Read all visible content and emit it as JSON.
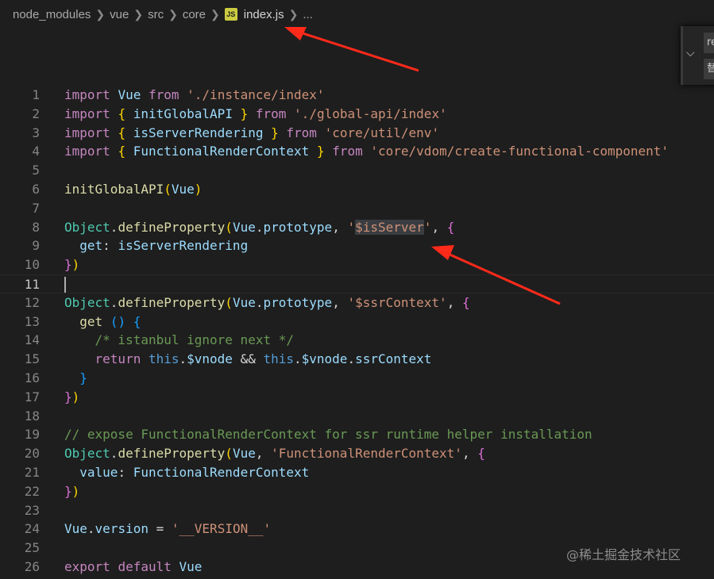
{
  "breadcrumb": {
    "items": [
      "node_modules",
      "vue",
      "src",
      "core"
    ],
    "file_icon": "JS",
    "file": "index.js",
    "more": "..."
  },
  "find_widget": {
    "toggle_icon": "chevron-down-icon",
    "find_value": "re",
    "replace_value": "替"
  },
  "editor": {
    "lines": [
      {
        "n": "1",
        "tokens": [
          [
            "kw",
            "import"
          ],
          [
            "punc",
            " "
          ],
          [
            "id",
            "Vue"
          ],
          [
            "punc",
            " "
          ],
          [
            "kw",
            "from"
          ],
          [
            "punc",
            " "
          ],
          [
            "str",
            "'./instance/index'"
          ]
        ]
      },
      {
        "n": "2",
        "tokens": [
          [
            "kw",
            "import"
          ],
          [
            "punc",
            " "
          ],
          [
            "br1",
            "{"
          ],
          [
            "punc",
            " "
          ],
          [
            "id",
            "initGlobalAPI"
          ],
          [
            "punc",
            " "
          ],
          [
            "br1",
            "}"
          ],
          [
            "punc",
            " "
          ],
          [
            "kw",
            "from"
          ],
          [
            "punc",
            " "
          ],
          [
            "str",
            "'./global-api/index'"
          ]
        ]
      },
      {
        "n": "3",
        "tokens": [
          [
            "kw",
            "import"
          ],
          [
            "punc",
            " "
          ],
          [
            "br1",
            "{"
          ],
          [
            "punc",
            " "
          ],
          [
            "id",
            "isServerRendering"
          ],
          [
            "punc",
            " "
          ],
          [
            "br1",
            "}"
          ],
          [
            "punc",
            " "
          ],
          [
            "kw",
            "from"
          ],
          [
            "punc",
            " "
          ],
          [
            "str",
            "'core/util/env'"
          ]
        ]
      },
      {
        "n": "4",
        "tokens": [
          [
            "kw",
            "import"
          ],
          [
            "punc",
            " "
          ],
          [
            "br1",
            "{"
          ],
          [
            "punc",
            " "
          ],
          [
            "id",
            "FunctionalRenderContext"
          ],
          [
            "punc",
            " "
          ],
          [
            "br1",
            "}"
          ],
          [
            "punc",
            " "
          ],
          [
            "kw",
            "from"
          ],
          [
            "punc",
            " "
          ],
          [
            "str",
            "'core/vdom/create-functional-component'"
          ]
        ]
      },
      {
        "n": "5",
        "tokens": []
      },
      {
        "n": "6",
        "tokens": [
          [
            "fn",
            "initGlobalAPI"
          ],
          [
            "br1",
            "("
          ],
          [
            "id",
            "Vue"
          ],
          [
            "br1",
            ")"
          ]
        ]
      },
      {
        "n": "7",
        "tokens": []
      },
      {
        "n": "8",
        "tokens": [
          [
            "type",
            "Object"
          ],
          [
            "punc",
            "."
          ],
          [
            "fn",
            "defineProperty"
          ],
          [
            "br1",
            "("
          ],
          [
            "id",
            "Vue"
          ],
          [
            "punc",
            "."
          ],
          [
            "id",
            "prototype"
          ],
          [
            "punc",
            ", "
          ],
          [
            "str",
            "'"
          ],
          [
            "str hl",
            "$isServer"
          ],
          [
            "str",
            "'"
          ],
          [
            "punc",
            ", "
          ],
          [
            "br2",
            "{"
          ]
        ]
      },
      {
        "n": "9",
        "tokens": [
          [
            "punc",
            "  "
          ],
          [
            "id",
            "get"
          ],
          [
            "punc",
            ": "
          ],
          [
            "id",
            "isServerRendering"
          ]
        ]
      },
      {
        "n": "10",
        "tokens": [
          [
            "br2",
            "}"
          ],
          [
            "br1",
            ")"
          ]
        ]
      },
      {
        "n": "11",
        "tokens": []
      },
      {
        "n": "12",
        "tokens": [
          [
            "type",
            "Object"
          ],
          [
            "punc",
            "."
          ],
          [
            "fn",
            "defineProperty"
          ],
          [
            "br1",
            "("
          ],
          [
            "id",
            "Vue"
          ],
          [
            "punc",
            "."
          ],
          [
            "id",
            "prototype"
          ],
          [
            "punc",
            ", "
          ],
          [
            "str",
            "'$ssrContext'"
          ],
          [
            "punc",
            ", "
          ],
          [
            "br2",
            "{"
          ]
        ]
      },
      {
        "n": "13",
        "tokens": [
          [
            "punc",
            "  "
          ],
          [
            "fn",
            "get"
          ],
          [
            "punc",
            " "
          ],
          [
            "br3",
            "()"
          ],
          [
            "punc",
            " "
          ],
          [
            "br3",
            "{"
          ]
        ]
      },
      {
        "n": "14",
        "tokens": [
          [
            "punc",
            "    "
          ],
          [
            "cmt",
            "/* istanbul ignore next */"
          ]
        ]
      },
      {
        "n": "15",
        "tokens": [
          [
            "punc",
            "    "
          ],
          [
            "kw",
            "return"
          ],
          [
            "punc",
            " "
          ],
          [
            "blue",
            "this"
          ],
          [
            "punc",
            "."
          ],
          [
            "id",
            "$vnode"
          ],
          [
            "punc",
            " && "
          ],
          [
            "blue",
            "this"
          ],
          [
            "punc",
            "."
          ],
          [
            "id",
            "$vnode"
          ],
          [
            "punc",
            "."
          ],
          [
            "id",
            "ssrContext"
          ]
        ]
      },
      {
        "n": "16",
        "tokens": [
          [
            "punc",
            "  "
          ],
          [
            "br3",
            "}"
          ]
        ]
      },
      {
        "n": "17",
        "tokens": [
          [
            "br2",
            "}"
          ],
          [
            "br1",
            ")"
          ]
        ]
      },
      {
        "n": "18",
        "tokens": []
      },
      {
        "n": "19",
        "tokens": [
          [
            "cmt",
            "// expose FunctionalRenderContext for ssr runtime helper installation"
          ]
        ]
      },
      {
        "n": "20",
        "tokens": [
          [
            "type",
            "Object"
          ],
          [
            "punc",
            "."
          ],
          [
            "fn",
            "defineProperty"
          ],
          [
            "br1",
            "("
          ],
          [
            "id",
            "Vue"
          ],
          [
            "punc",
            ", "
          ],
          [
            "str",
            "'FunctionalRenderContext'"
          ],
          [
            "punc",
            ", "
          ],
          [
            "br2",
            "{"
          ]
        ]
      },
      {
        "n": "21",
        "tokens": [
          [
            "punc",
            "  "
          ],
          [
            "id",
            "value"
          ],
          [
            "punc",
            ": "
          ],
          [
            "id",
            "FunctionalRenderContext"
          ]
        ]
      },
      {
        "n": "22",
        "tokens": [
          [
            "br2",
            "}"
          ],
          [
            "br1",
            ")"
          ]
        ]
      },
      {
        "n": "23",
        "tokens": []
      },
      {
        "n": "24",
        "tokens": [
          [
            "id",
            "Vue"
          ],
          [
            "punc",
            "."
          ],
          [
            "id",
            "version"
          ],
          [
            "punc",
            " = "
          ],
          [
            "str",
            "'__VERSION__'"
          ]
        ]
      },
      {
        "n": "25",
        "tokens": []
      },
      {
        "n": "26",
        "tokens": [
          [
            "kw",
            "export"
          ],
          [
            "punc",
            " "
          ],
          [
            "kw",
            "default"
          ],
          [
            "punc",
            " "
          ],
          [
            "id",
            "Vue"
          ]
        ]
      }
    ],
    "current_line": "11"
  },
  "watermark": "@稀土掘金技术社区",
  "annotation_color": "#ff2a1a"
}
